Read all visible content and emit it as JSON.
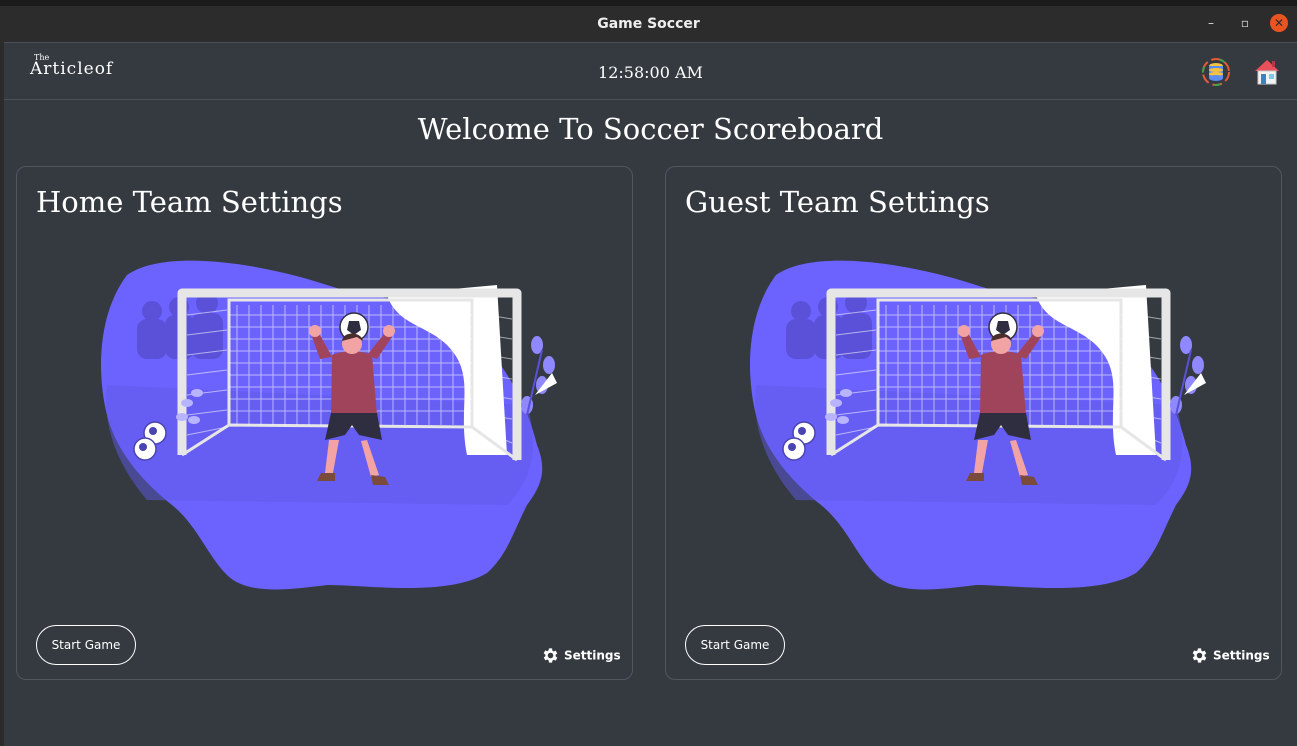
{
  "window": {
    "title": "Game Soccer",
    "controls": {
      "minimize": "–",
      "maximize": "▫",
      "close": "✕"
    }
  },
  "header": {
    "logo_small": "The",
    "logo_main": "Articleof",
    "clock": "12:58:00 AM",
    "icons": [
      "database-icon",
      "home-icon"
    ]
  },
  "welcome": "Welcome To Soccer Scoreboard",
  "cards": {
    "home": {
      "title": "Home Team Settings",
      "start_label": "Start Game",
      "settings_label": "Settings"
    },
    "guest": {
      "title": "Guest Team Settings",
      "start_label": "Start Game",
      "settings_label": "Settings"
    }
  },
  "colors": {
    "background": "#343a40",
    "accent_purple": "#6c63ff",
    "jersey": "#a0445c",
    "titlebar": "#2c2c2c",
    "close_button": "#e95420"
  }
}
